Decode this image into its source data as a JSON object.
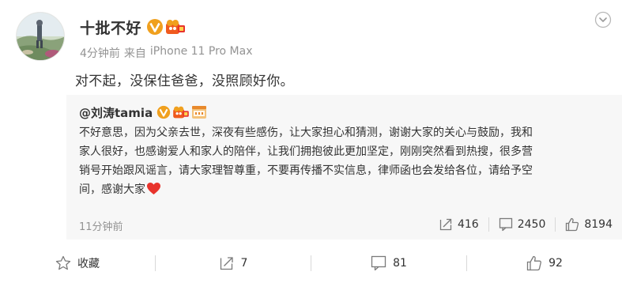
{
  "post": {
    "author": "十批不好",
    "time": "4分钟前",
    "source_prefix": "来自",
    "source_device": "iPhone 11 Pro Max",
    "text": "对不起，没保住爸爸，没照顾好你。"
  },
  "repost": {
    "author": "@刘涛tamia",
    "text_lines": [
      "不好意思，因为父亲去世，深夜有些感伤，让大家担心和猜测，谢谢大家的关心与鼓励，我和",
      "家人很好，也感谢爱人和家人的陪伴，让我们拥抱彼此更加坚定，刚刚突然看到热搜，很多营",
      "销号开始跟风谣言，请大家理智尊重，不要再传播不实信息，律师函也会发给各位，请给予空",
      "间，感谢大家"
    ],
    "time": "11分钟前",
    "reposts": "416",
    "comments": "2450",
    "likes": "8194"
  },
  "toolbar": {
    "favorite_label": "收藏",
    "repost_count": "7",
    "comment_count": "81",
    "like_count": "92"
  },
  "icons": {
    "more": "chevron-down-icon",
    "verified": "verified-v-badge-icon",
    "fan": "fan-badge-icon",
    "movie": "movie-badge-icon",
    "heart": "heart-icon",
    "favorite": "star-icon",
    "repost": "repost-icon",
    "comment": "comment-icon",
    "like": "thumbs-up-icon"
  },
  "colors": {
    "primary_text": "#333333",
    "meta_text": "#939393",
    "repost_bg": "#f7f7f7",
    "badge_orange": "#f0a01e",
    "heart_red": "#e8332c"
  }
}
